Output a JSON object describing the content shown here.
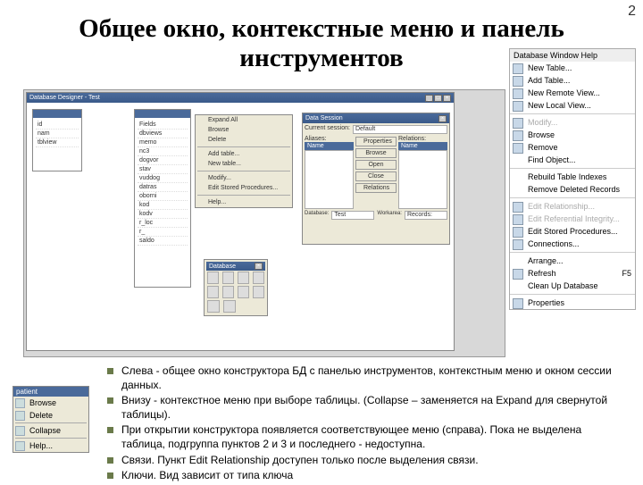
{
  "page_number": "2",
  "title": "Общее окно, контекстные меню и панель инструментов",
  "designer": {
    "title": "Database Designer - Test",
    "left_panel": {
      "header": "",
      "items": [
        "id",
        "nam",
        "tblview"
      ]
    },
    "mid_panel": {
      "header": "",
      "items": [
        "Fields",
        "dbviews",
        "memo",
        "nc3",
        "dogvor",
        "stav",
        "vuddog",
        "datras",
        "oborni",
        "kod",
        "kodv",
        "r_loc",
        "r_",
        "saldo"
      ]
    },
    "ctx": [
      "Expand All",
      "Browse",
      "Delete",
      "",
      "Add table...",
      "New table...",
      "",
      "Modify...",
      "Edit Stored Procedures...",
      "",
      "Help..."
    ],
    "session": {
      "title": "Data Session",
      "cur_lbl": "Current session:",
      "cur_val": "Default",
      "aliases": "Aliases:",
      "relations": "Relations:",
      "left_hdr": "Name",
      "right_hdr": "Name",
      "btns": [
        "Properties",
        "Browse",
        "Open",
        "Close",
        "Relations"
      ],
      "bottom_lbl1": "Database:",
      "bottom_val1": "Test",
      "bottom_lbl2": "Workarea:",
      "bottom_val2": "Records:"
    },
    "toolbar_title": "Database"
  },
  "right_menu": {
    "header": "Database  Window  Help",
    "items": [
      {
        "label": "New Table...",
        "icon": true
      },
      {
        "label": "Add Table...",
        "icon": true
      },
      {
        "label": "New Remote View...",
        "icon": true
      },
      {
        "label": "New Local View...",
        "icon": true
      },
      {
        "sep": true
      },
      {
        "label": "Modify...",
        "icon": true,
        "disabled": true
      },
      {
        "label": "Browse",
        "icon": true
      },
      {
        "label": "Remove",
        "icon": true
      },
      {
        "label": "Find Object...",
        "icon": false
      },
      {
        "sep": true
      },
      {
        "label": "Rebuild Table Indexes",
        "icon": false
      },
      {
        "label": "Remove Deleted Records",
        "icon": false
      },
      {
        "sep": true
      },
      {
        "label": "Edit Relationship...",
        "icon": true,
        "disabled": true
      },
      {
        "label": "Edit Referential Integrity...",
        "icon": true,
        "disabled": true
      },
      {
        "label": "Edit Stored Procedures...",
        "icon": true
      },
      {
        "label": "Connections...",
        "icon": true
      },
      {
        "sep": true
      },
      {
        "label": "Arrange...",
        "icon": false
      },
      {
        "label": "Refresh",
        "icon": true,
        "key": "F5"
      },
      {
        "label": "Clean Up Database",
        "icon": false
      },
      {
        "sep": true
      },
      {
        "label": "Properties",
        "icon": true
      }
    ]
  },
  "small_menu": {
    "header": "patient",
    "items": [
      "Browse",
      "Delete",
      "",
      "Collapse",
      "",
      "Help..."
    ]
  },
  "bullets": [
    "Слева  - общее окно конструктора БД с панелью инструментов, контекстным меню и окном сессии данных.",
    "Внизу  - контекстное меню при выборе таблицы. (Collapse – заменяется на Expand для свернутой таблицы).",
    "При открытии конструктора появляется соответствующее меню (справа). Пока не выделена таблица, подгруппа пунктов 2 и 3 и последнего  - недоступна.",
    "Связи. Пункт Edit Relationship доступен только после выделения связи.",
    "Ключи. Вид зависит от типа ключа"
  ]
}
